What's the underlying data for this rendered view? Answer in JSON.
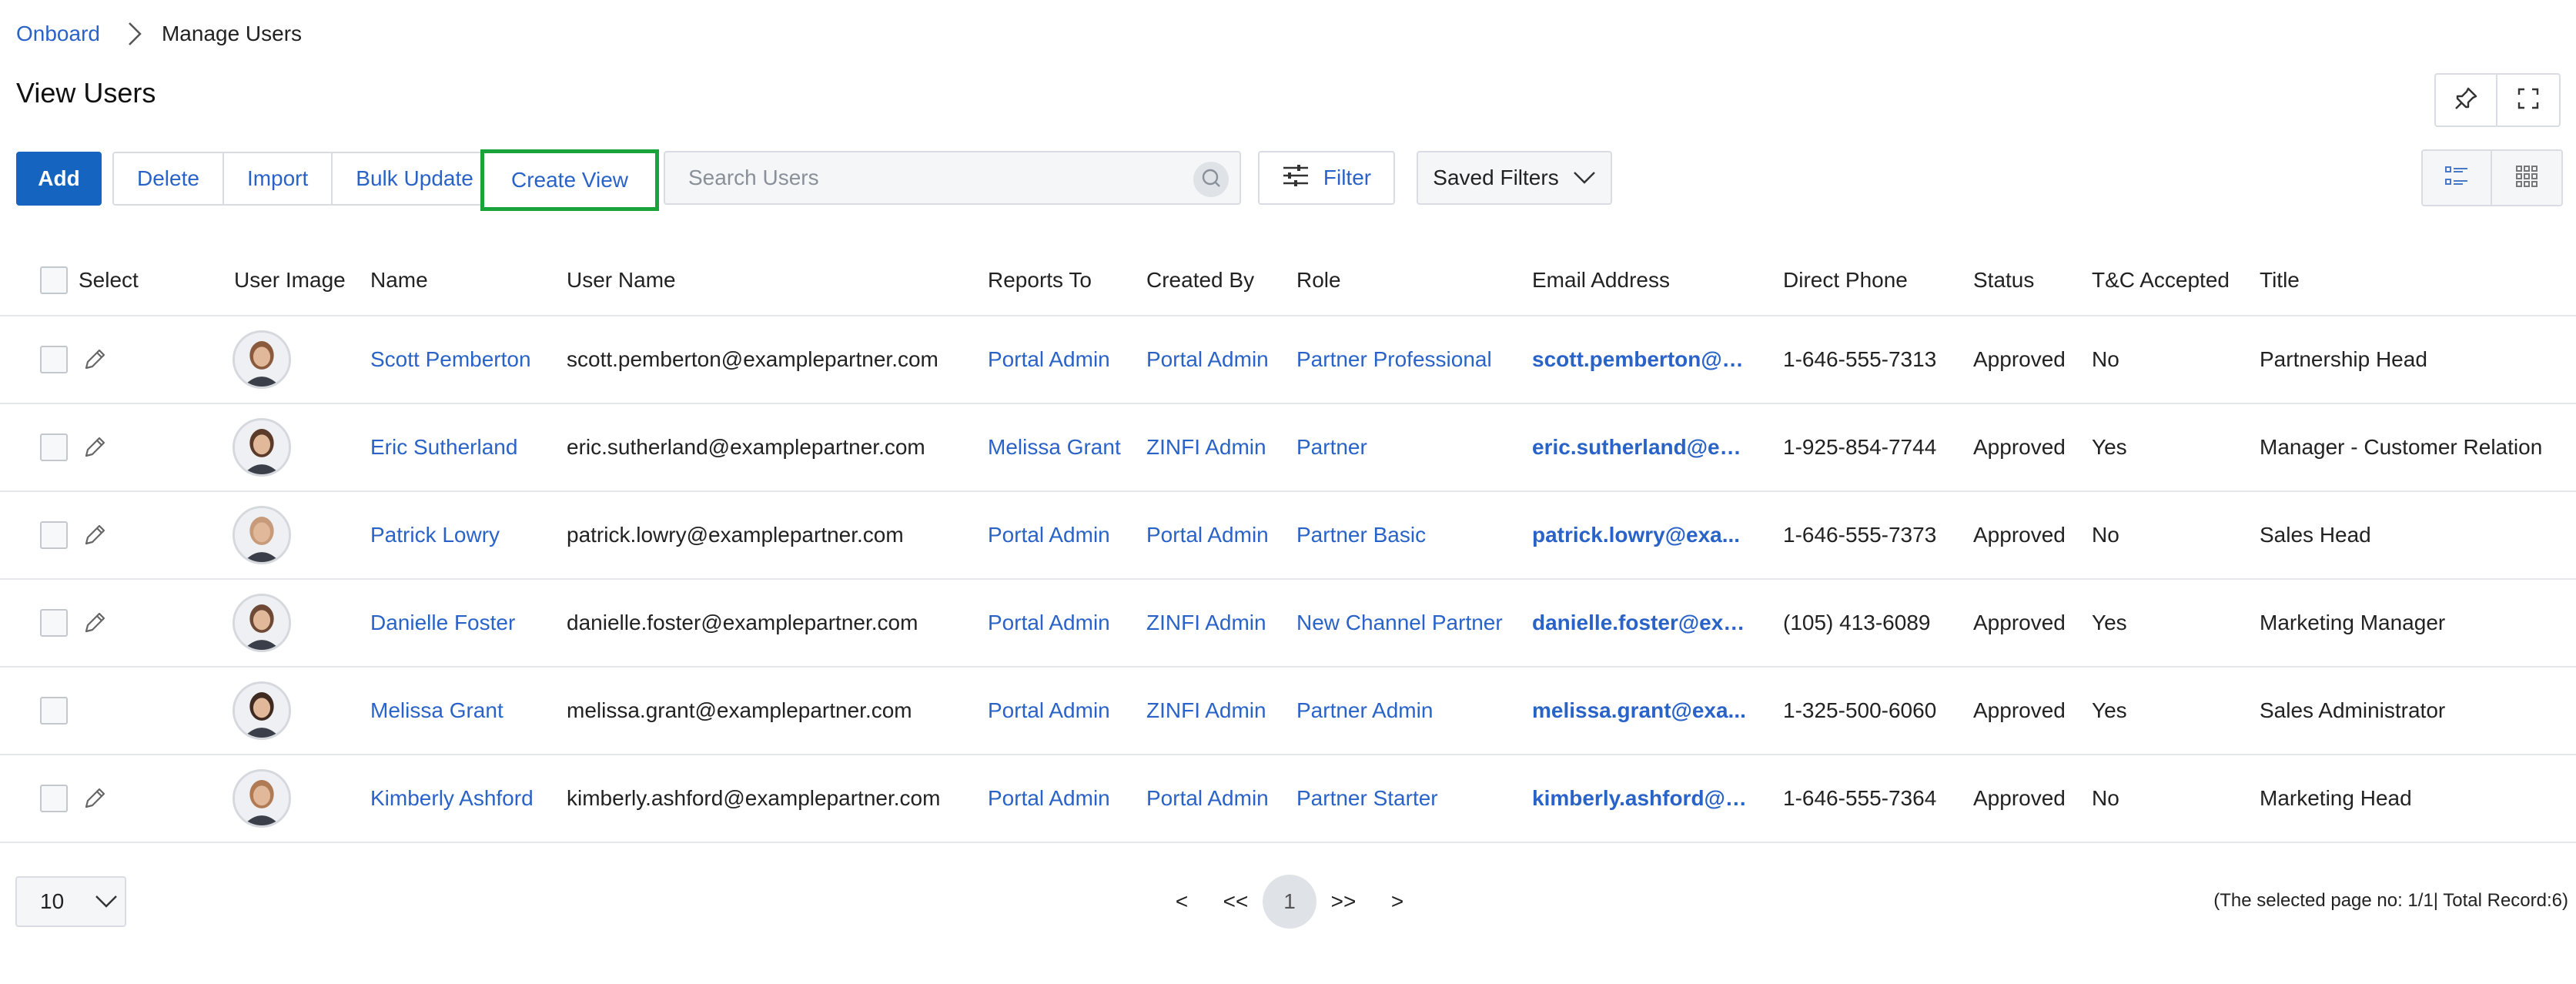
{
  "breadcrumb": {
    "root": "Onboard",
    "current": "Manage Users"
  },
  "page_title": "View Users",
  "toolbar": {
    "add": "Add",
    "delete": "Delete",
    "import": "Import",
    "bulk_update": "Bulk Update",
    "create_view": "Create View",
    "search_placeholder": "Search Users",
    "filter": "Filter",
    "saved_filters": "Saved Filters"
  },
  "columns": {
    "select": "Select",
    "user_image": "User Image",
    "name": "Name",
    "user_name": "User Name",
    "reports_to": "Reports To",
    "created_by": "Created By",
    "role": "Role",
    "email": "Email Address",
    "phone": "Direct Phone",
    "status": "Status",
    "tc": "T&C Accepted",
    "title": "Title"
  },
  "rows": [
    {
      "name": "Scott Pemberton",
      "user_name": "scott.pemberton@examplepartner.com",
      "reports_to": "Portal Admin",
      "created_by": "Portal Admin",
      "role": "Partner Professional",
      "email": "scott.pemberton@e...",
      "phone": "1-646-555-7313",
      "status": "Approved",
      "tc": "No",
      "title": "Partnership Head",
      "editable": true
    },
    {
      "name": "Eric Sutherland",
      "user_name": "eric.sutherland@examplepartner.com",
      "reports_to": "Melissa Grant",
      "created_by": "ZINFI Admin",
      "role": "Partner",
      "email": "eric.sutherland@ex...",
      "phone": "1-925-854-7744",
      "status": "Approved",
      "tc": "Yes",
      "title": "Manager - Customer Relation",
      "editable": true
    },
    {
      "name": "Patrick Lowry",
      "user_name": "patrick.lowry@examplepartner.com",
      "reports_to": "Portal Admin",
      "created_by": "Portal Admin",
      "role": "Partner Basic",
      "email": "patrick.lowry@exa...",
      "phone": "1-646-555-7373",
      "status": "Approved",
      "tc": "No",
      "title": "Sales Head",
      "editable": true
    },
    {
      "name": "Danielle Foster",
      "user_name": "danielle.foster@examplepartner.com",
      "reports_to": "Portal Admin",
      "created_by": "ZINFI Admin",
      "role": "New Channel Partner",
      "email": "danielle.foster@exa...",
      "phone": "(105) 413-6089",
      "status": "Approved",
      "tc": "Yes",
      "title": "Marketing Manager",
      "editable": true
    },
    {
      "name": "Melissa Grant",
      "user_name": "melissa.grant@examplepartner.com",
      "reports_to": "Portal Admin",
      "created_by": "ZINFI Admin",
      "role": "Partner Admin",
      "email": "melissa.grant@exa...",
      "phone": "1-325-500-6060",
      "status": "Approved",
      "tc": "Yes",
      "title": "Sales Administrator",
      "editable": false
    },
    {
      "name": "Kimberly Ashford",
      "user_name": "kimberly.ashford@examplepartner.com",
      "reports_to": "Portal Admin",
      "created_by": "Portal Admin",
      "role": "Partner Starter",
      "email": "kimberly.ashford@e...",
      "phone": "1-646-555-7364",
      "status": "Approved",
      "tc": "No",
      "title": "Marketing Head",
      "editable": true
    }
  ],
  "pagination": {
    "page_size": "10",
    "prev": "<",
    "first": "<<",
    "current": "1",
    "last": ">>",
    "next": ">",
    "record_info": "(The selected page no: 1/1| Total Record:6)"
  },
  "colors": {
    "accent": "#1565c0",
    "link": "#2a63c8",
    "highlight": "#1aa33b"
  },
  "avatar_tones": [
    "#8a5a3c",
    "#5b3a2a",
    "#c79a7a",
    "#6e4a36",
    "#3e2a20",
    "#b07a55"
  ]
}
